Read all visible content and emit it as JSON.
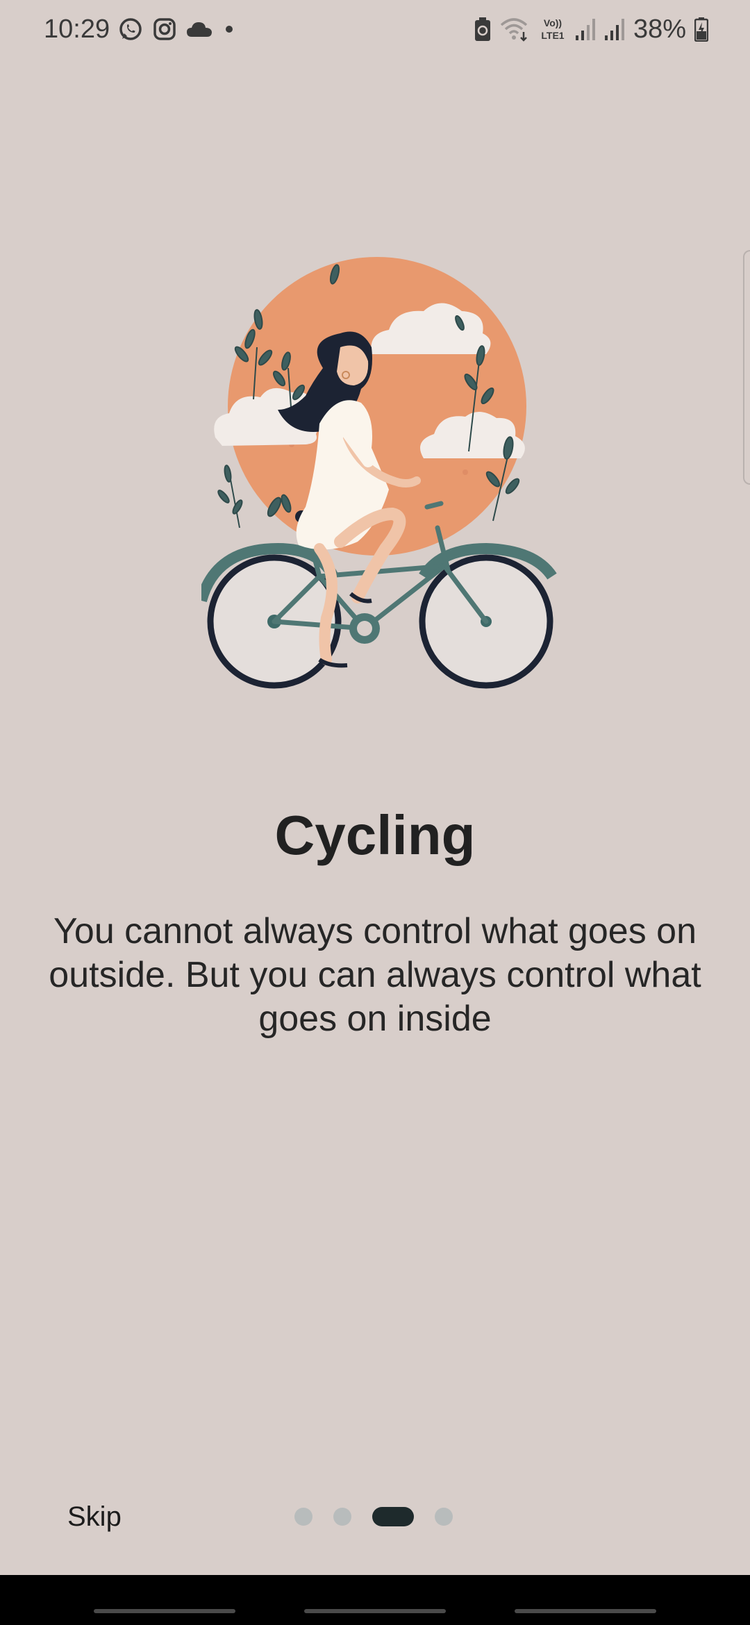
{
  "status_bar": {
    "time": "10:29",
    "battery": "38%",
    "left_icons": [
      "whatsapp-icon",
      "instagram-icon",
      "cloud-icon",
      "dot-icon"
    ],
    "right_icons": [
      "battery-saver-icon",
      "wifi-icon",
      "volte-icon",
      "signal-icon",
      "signal-icon",
      "battery-icon"
    ],
    "volte_label": "Vo))",
    "lte_label": "LTE1"
  },
  "onboarding": {
    "title": "Cycling",
    "description": "You cannot always control what goes on outside. But you can always control what goes on inside",
    "illustration": "woman-cycling-illustration",
    "pages": 4,
    "active_page": 3
  },
  "controls": {
    "skip_label": "Skip"
  },
  "colors": {
    "background": "#d8ceca",
    "sun": "#e8996e",
    "active_dot": "#1e2a2c",
    "inactive_dot": "#b8bcbc"
  }
}
